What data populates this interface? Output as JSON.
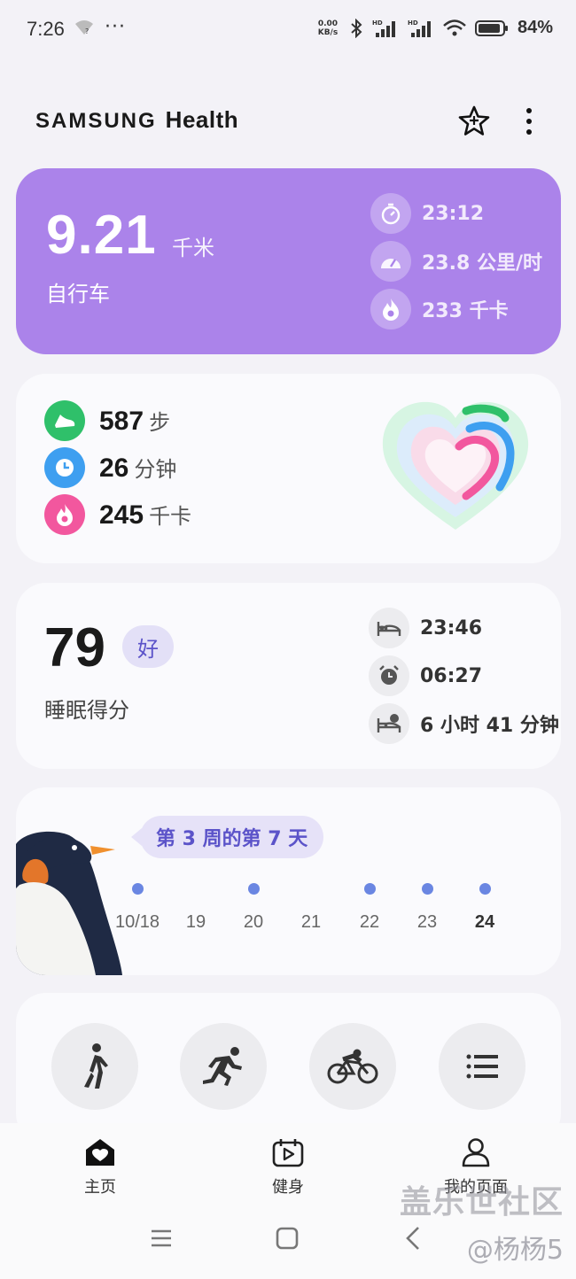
{
  "status_bar": {
    "time": "7:26",
    "more": "···",
    "net_speed": "0.00",
    "net_unit": "KB/s",
    "battery": "84%"
  },
  "app": {
    "brand": "SAMSUNG",
    "name": "Health"
  },
  "bike_card": {
    "distance": "9.21",
    "unit": "千米",
    "type": "自行车",
    "duration": "23:12",
    "speed": "23.8 公里/时",
    "calories": "233 千卡"
  },
  "activity_card": {
    "steps_value": "587",
    "steps_unit": "步",
    "active_value": "26",
    "active_unit": "分钟",
    "calories_value": "245",
    "calories_unit": "千卡"
  },
  "sleep_card": {
    "score": "79",
    "rating": "好",
    "label": "睡眠得分",
    "bedtime": "23:46",
    "wake": "06:27",
    "duration": "6 小时 41 分钟"
  },
  "week_card": {
    "bubble": "第 3 周的第 7 天",
    "days": [
      {
        "label": "10/18",
        "done": true
      },
      {
        "label": "19",
        "done": false
      },
      {
        "label": "20",
        "done": true
      },
      {
        "label": "21",
        "done": false
      },
      {
        "label": "22",
        "done": true
      },
      {
        "label": "23",
        "done": true
      },
      {
        "label": "24",
        "done": true
      }
    ]
  },
  "shortcuts": [
    "walk-icon",
    "run-icon",
    "bike-icon",
    "list-icon"
  ],
  "bottom_nav": {
    "home": "主页",
    "fitness": "健身",
    "my_page": "我的页面"
  },
  "watermark": {
    "line1": "盖乐世社区",
    "line2": "@杨杨5"
  },
  "colors": {
    "bike": "#ab83ea",
    "steps": "#2fc06a",
    "active": "#3e9ff0",
    "calories": "#f2579e",
    "accent": "#5b53c9"
  }
}
